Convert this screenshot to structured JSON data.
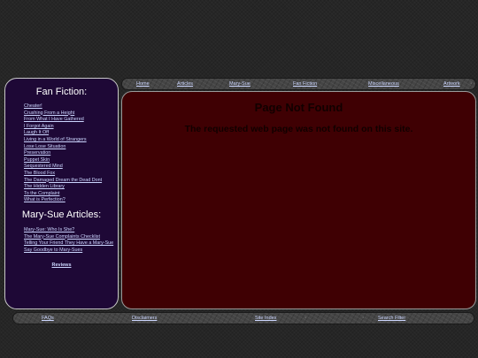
{
  "top_nav": {
    "items": [
      {
        "label": "Home"
      },
      {
        "label": "Articles"
      },
      {
        "label": "Mary-Sue"
      },
      {
        "label": "Fan Fiction"
      },
      {
        "label": "Miscellaneous"
      },
      {
        "label": "Artwork"
      }
    ]
  },
  "sidebar": {
    "fan_fiction_heading": "Fan Fiction:",
    "fan_fiction_links": [
      "Cheater!",
      "Crushing From a Height",
      "From What I Have Gathered",
      "I Forgot Again",
      "Laugh It Off",
      "Living in a World of Strangers",
      "Lose Lose Situation",
      "Preservation",
      "Puppet Skin",
      "Sequestered Mind",
      "The Blood Fox",
      "The Damaged Dream the Dead Dont",
      "The Hidden Library",
      "To the Complaint",
      "What is Perfection?"
    ],
    "mary_sue_heading": "Mary-Sue Articles:",
    "mary_sue_links": [
      "Mary-Sue: Who Is She?",
      "The Mary-Sue Complaints Checklist",
      "Telling Your Friend They Have a Mary-Sue",
      "Say Goodbye to Mary-Sues"
    ],
    "reviews_label": "Reviews"
  },
  "main": {
    "title": "Page Not Found",
    "message": "The requested web page was not found on this site."
  },
  "bottom_nav": {
    "items": [
      {
        "label": "FAQs"
      },
      {
        "label": "Disclaimers"
      },
      {
        "label": "Site Index"
      },
      {
        "label": "Search Filter"
      }
    ]
  },
  "colors": {
    "background": "#262626",
    "sidebar_bg": "#1e0836",
    "main_bg": "#3f0003",
    "link": "#ccd6ff",
    "nav_bar": "#454545"
  }
}
